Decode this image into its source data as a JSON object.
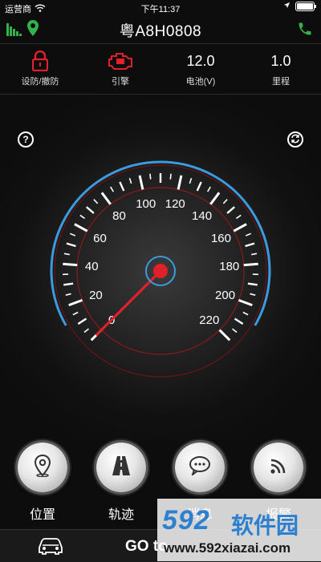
{
  "status_bar": {
    "carrier": "运营商",
    "time": "下午11:37"
  },
  "header": {
    "plate": "粤A8H0808"
  },
  "stats": [
    {
      "id": "arm",
      "label": "设防/撤防",
      "icon": "lock-icon",
      "color": "#e0202a"
    },
    {
      "id": "engine",
      "label": "引擎",
      "icon": "engine-icon",
      "color": "#e0202a"
    },
    {
      "id": "battery",
      "label": "电池(V)",
      "value": "12.0"
    },
    {
      "id": "mileage",
      "label": "里程",
      "value": "1.0"
    }
  ],
  "gauge": {
    "speed_value": 0,
    "max_speed": 220,
    "tick_labels": [
      "0",
      "20",
      "40",
      "60",
      "80",
      "100",
      "120",
      "140",
      "160",
      "180",
      "200",
      "220"
    ],
    "arc_color": "#3a9be0",
    "needle_color": "#e0202a"
  },
  "actions": [
    {
      "id": "location",
      "label": "位置",
      "icon": "location-pin-icon"
    },
    {
      "id": "track",
      "label": "轨迹",
      "icon": "road-icon"
    },
    {
      "id": "messages",
      "label": "消息",
      "icon": "chat-bubble-icon"
    },
    {
      "id": "alarm",
      "label": "报警",
      "icon": "signal-waves-icon"
    }
  ],
  "bottom": {
    "go_text": "GO to"
  },
  "watermark": {
    "number": "592",
    "name": "软件园",
    "url": "www.592xiazai.com"
  }
}
